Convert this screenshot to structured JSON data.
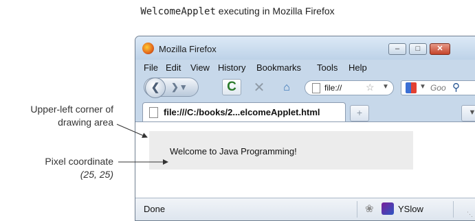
{
  "caption": {
    "code": "WelcomeApplet",
    "rest": " executing in Mozilla Firefox"
  },
  "annotations": {
    "corner_line1": "Upper-left corner of",
    "corner_line2": "drawing area",
    "pixel_line1": "Pixel coordinate",
    "pixel_line2": "(25, 25)"
  },
  "window": {
    "title": "Mozilla Firefox",
    "buttons": {
      "minimize": "–",
      "maximize": "□",
      "close": "✕"
    }
  },
  "menu": [
    "File",
    "Edit",
    "View",
    "History",
    "Bookmarks",
    "Tools",
    "Help"
  ],
  "navbar": {
    "url_text": "file://",
    "search_placeholder": "Goo"
  },
  "tab": {
    "label": "file:///C:/books/2...elcomeApplet.html",
    "new_tab": "+"
  },
  "applet": {
    "text": "Welcome to Java Programming!"
  },
  "statusbar": {
    "text": "Done",
    "addon_label": "YSlow"
  }
}
